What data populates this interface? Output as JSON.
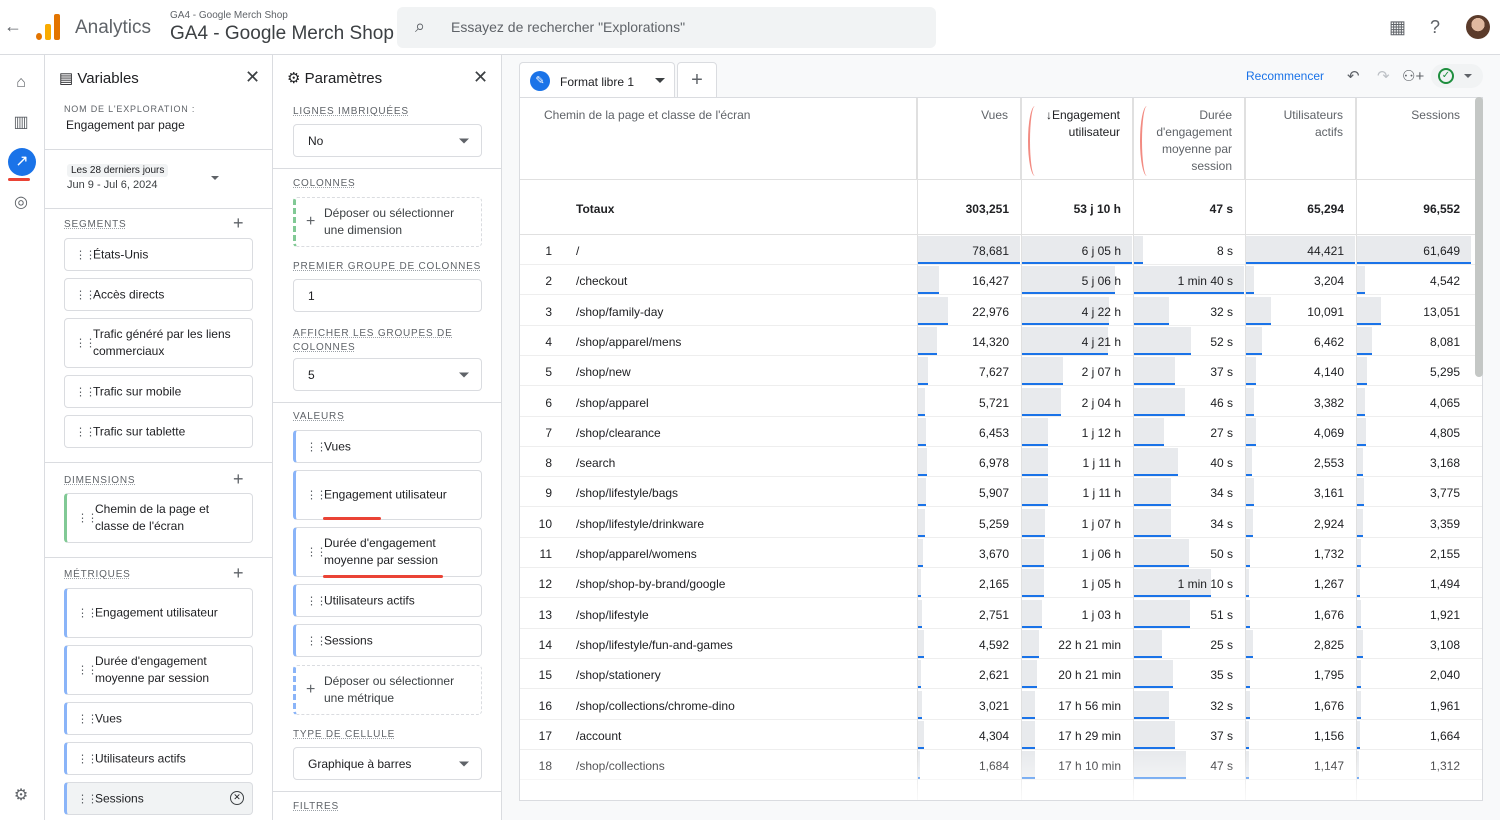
{
  "app": {
    "name": "Analytics",
    "account_small": "GA4 - Google Merch Shop",
    "account_big": "GA4 - Google Merch Shop",
    "search_placeholder": "Essayez de rechercher \"Explorations\""
  },
  "variables": {
    "title": "Variables",
    "name_label": "NOM DE L'EXPLORATION :",
    "name_value": "Engagement par page",
    "date_chip": "Les 28 derniers jours",
    "date_range": "Jun 9 - Jul 6, 2024",
    "segments_label": "SEGMENTS",
    "segments": [
      "États-Unis",
      "Accès directs",
      "Trafic généré par les liens commerciaux",
      "Trafic sur mobile",
      "Trafic sur tablette"
    ],
    "dimensions_label": "DIMENSIONS",
    "dimensions": [
      "Chemin de la page et classe de l'écran"
    ],
    "metrics_label": "MÉTRIQUES",
    "metrics": [
      "Engagement utilisateur",
      "Durée d'engagement moyenne par session",
      "Vues",
      "Utilisateurs actifs",
      "Sessions"
    ]
  },
  "settings": {
    "title": "Paramètres",
    "nested_rows_label": "LIGNES IMBRIQUÉES",
    "nested_rows_value": "No",
    "columns_label": "COLONNES",
    "columns_drop": "Déposer ou sélectionner une dimension",
    "first_group_label": "PREMIER GROUPE DE COLONNES",
    "first_group_value": "1",
    "show_groups_label": "AFFICHER LES GROUPES DE COLONNES",
    "show_groups_value": "5",
    "values_label": "VALEURS",
    "values": [
      "Vues",
      "Engagement utilisateur",
      "Durée d'engagement moyenne par session",
      "Utilisateurs actifs",
      "Sessions"
    ],
    "values_drop": "Déposer ou sélectionner une métrique",
    "cell_type_label": "TYPE DE CELLULE",
    "cell_type_value": "Graphique à barres",
    "filters_label": "FILTRES"
  },
  "canvas": {
    "tab_name": "Format libre 1",
    "reset_label": "Recommencer"
  },
  "table": {
    "headers": {
      "dim": "Chemin de la page et classe de l'écran",
      "views": "Vues",
      "engagement": "↓Engagement utilisateur",
      "duration": "Durée d'engagement moyenne par session",
      "active": "Utilisateurs actifs",
      "sessions": "Sessions"
    },
    "totals": {
      "label": "Totaux",
      "views": "303,251",
      "engagement": "53 j 10 h",
      "duration": "47 s",
      "active": "65,294",
      "sessions": "96,552"
    },
    "rows": [
      {
        "n": "1",
        "path": "/",
        "views": "78,681",
        "eng": "6 j 05 h",
        "dur": "8 s",
        "active": "44,421",
        "sessions": "61,649"
      },
      {
        "n": "2",
        "path": "/checkout",
        "views": "16,427",
        "eng": "5 j 06 h",
        "dur": "1 min 40 s",
        "active": "3,204",
        "sessions": "4,542"
      },
      {
        "n": "3",
        "path": "/shop/family-day",
        "views": "22,976",
        "eng": "4 j 22 h",
        "dur": "32 s",
        "active": "10,091",
        "sessions": "13,051"
      },
      {
        "n": "4",
        "path": "/shop/apparel/mens",
        "views": "14,320",
        "eng": "4 j 21 h",
        "dur": "52 s",
        "active": "6,462",
        "sessions": "8,081"
      },
      {
        "n": "5",
        "path": "/shop/new",
        "views": "7,627",
        "eng": "2 j 07 h",
        "dur": "37 s",
        "active": "4,140",
        "sessions": "5,295"
      },
      {
        "n": "6",
        "path": "/shop/apparel",
        "views": "5,721",
        "eng": "2 j 04 h",
        "dur": "46 s",
        "active": "3,382",
        "sessions": "4,065"
      },
      {
        "n": "7",
        "path": "/shop/clearance",
        "views": "6,453",
        "eng": "1 j 12 h",
        "dur": "27 s",
        "active": "4,069",
        "sessions": "4,805"
      },
      {
        "n": "8",
        "path": "/search",
        "views": "6,978",
        "eng": "1 j 11 h",
        "dur": "40 s",
        "active": "2,553",
        "sessions": "3,168"
      },
      {
        "n": "9",
        "path": "/shop/lifestyle/bags",
        "views": "5,907",
        "eng": "1 j 11 h",
        "dur": "34 s",
        "active": "3,161",
        "sessions": "3,775"
      },
      {
        "n": "10",
        "path": "/shop/lifestyle/drinkware",
        "views": "5,259",
        "eng": "1 j 07 h",
        "dur": "34 s",
        "active": "2,924",
        "sessions": "3,359"
      },
      {
        "n": "11",
        "path": "/shop/apparel/womens",
        "views": "3,670",
        "eng": "1 j 06 h",
        "dur": "50 s",
        "active": "1,732",
        "sessions": "2,155"
      },
      {
        "n": "12",
        "path": "/shop/shop-by-brand/google",
        "views": "2,165",
        "eng": "1 j 05 h",
        "dur": "1 min 10 s",
        "active": "1,267",
        "sessions": "1,494"
      },
      {
        "n": "13",
        "path": "/shop/lifestyle",
        "views": "2,751",
        "eng": "1 j 03 h",
        "dur": "51 s",
        "active": "1,676",
        "sessions": "1,921"
      },
      {
        "n": "14",
        "path": "/shop/lifestyle/fun-and-games",
        "views": "4,592",
        "eng": "22 h 21 min",
        "dur": "25 s",
        "active": "2,825",
        "sessions": "3,108"
      },
      {
        "n": "15",
        "path": "/shop/stationery",
        "views": "2,621",
        "eng": "20 h 21 min",
        "dur": "35 s",
        "active": "1,795",
        "sessions": "2,040"
      },
      {
        "n": "16",
        "path": "/shop/collections/chrome-dino",
        "views": "3,021",
        "eng": "17 h 56 min",
        "dur": "32 s",
        "active": "1,676",
        "sessions": "1,961"
      },
      {
        "n": "17",
        "path": "/account",
        "views": "4,304",
        "eng": "17 h 29 min",
        "dur": "37 s",
        "active": "1,156",
        "sessions": "1,664"
      },
      {
        "n": "18",
        "path": "/shop/collections",
        "views": "1,684",
        "eng": "17 h 10 min",
        "dur": "47 s",
        "active": "1,147",
        "sessions": "1,312"
      }
    ],
    "bars": {
      "views": [
        1.0,
        0.209,
        0.292,
        0.182,
        0.097,
        0.073,
        0.082,
        0.089,
        0.075,
        0.067,
        0.047,
        0.028,
        0.035,
        0.058,
        0.033,
        0.038,
        0.055,
        0.021
      ],
      "engagement": [
        1.0,
        0.846,
        0.793,
        0.786,
        0.37,
        0.35,
        0.24,
        0.233,
        0.233,
        0.21,
        0.203,
        0.196,
        0.183,
        0.15,
        0.136,
        0.12,
        0.117,
        0.115
      ],
      "duration": [
        0.08,
        1.0,
        0.32,
        0.52,
        0.37,
        0.46,
        0.27,
        0.4,
        0.34,
        0.34,
        0.5,
        0.7,
        0.51,
        0.25,
        0.35,
        0.32,
        0.37,
        0.47
      ],
      "active": [
        1.0,
        0.072,
        0.227,
        0.145,
        0.093,
        0.076,
        0.092,
        0.057,
        0.071,
        0.066,
        0.039,
        0.029,
        0.038,
        0.064,
        0.04,
        0.038,
        0.026,
        0.026
      ],
      "sessions": [
        1.0,
        0.074,
        0.212,
        0.131,
        0.086,
        0.066,
        0.078,
        0.051,
        0.061,
        0.054,
        0.035,
        0.024,
        0.031,
        0.05,
        0.033,
        0.032,
        0.027,
        0.021
      ]
    }
  }
}
